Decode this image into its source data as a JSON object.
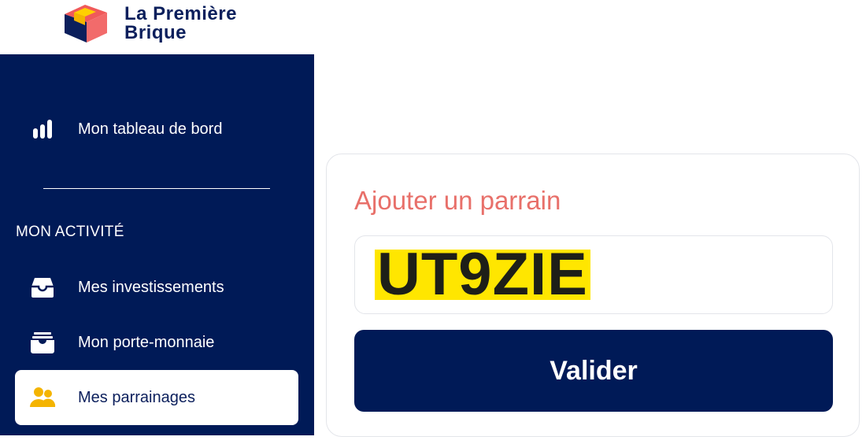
{
  "brand": {
    "name_line1": "La Première",
    "name_line2": "Brique",
    "colors": {
      "navy": "#001a57",
      "coral": "#e8706a",
      "yellow": "#ffd000",
      "red": "#f05a5a"
    }
  },
  "sidebar": {
    "top_item": {
      "label": "Mon tableau de bord",
      "icon": "bar-chart-icon"
    },
    "section_title": "MON ACTIVITÉ",
    "items": [
      {
        "label": "Mes investissements",
        "icon": "inbox-tray-icon",
        "active": false
      },
      {
        "label": "Mon porte-monnaie",
        "icon": "wallet-box-icon",
        "active": false
      },
      {
        "label": "Mes parrainages",
        "icon": "users-icon",
        "active": true
      }
    ]
  },
  "referral_card": {
    "title": "Ajouter un parrain",
    "code_value": "UT9ZIE",
    "submit_label": "Valider"
  }
}
